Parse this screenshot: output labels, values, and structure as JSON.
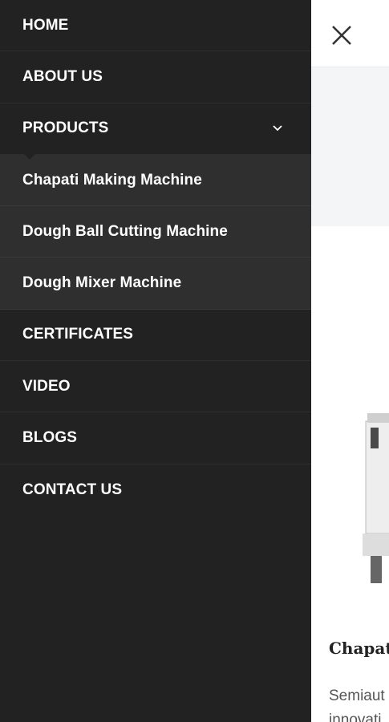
{
  "menu": {
    "items": [
      {
        "label": "HOME"
      },
      {
        "label": "ABOUT US"
      },
      {
        "label": "PRODUCTS"
      },
      {
        "label": "CERTIFICATES"
      },
      {
        "label": "VIDEO"
      },
      {
        "label": "BLOGS"
      },
      {
        "label": "CONTACT US"
      }
    ],
    "submenu": [
      {
        "label": "Chapati Making Machine"
      },
      {
        "label": "Dough Ball Cutting Machine"
      },
      {
        "label": "Dough Mixer Machine"
      }
    ]
  },
  "page": {
    "product_title": "Chapat",
    "product_desc_line1": "Semiaut",
    "product_desc_line2": "innovati"
  },
  "icons": {
    "close": "close-icon",
    "chevron": "chevron-down-icon"
  },
  "colors": {
    "drawer_bg": "#222222",
    "submenu_bg": "#2f2f2f",
    "text": "#ffffff"
  }
}
